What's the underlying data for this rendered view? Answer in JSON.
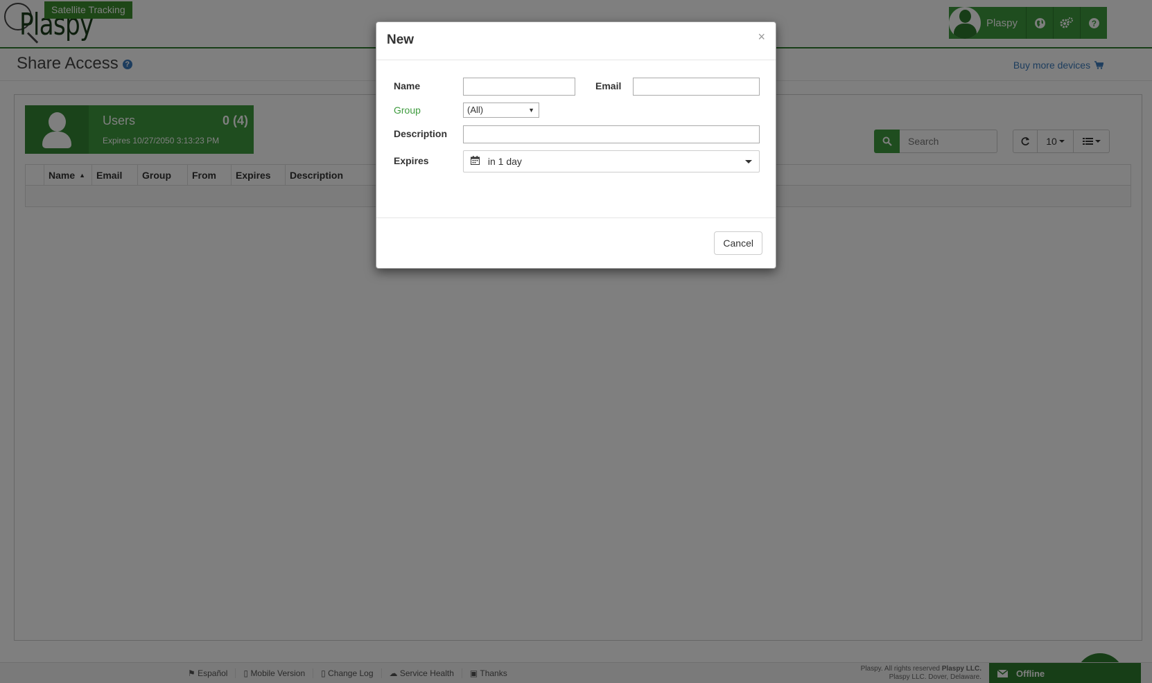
{
  "app": {
    "logo_text": "Plaspy",
    "badge": "Satellite Tracking",
    "user_name": "Plaspy"
  },
  "header_icons": [
    "globe-icon",
    "gears-icon",
    "question-icon"
  ],
  "page": {
    "title": "Share Access",
    "buy_link": "Buy more devices"
  },
  "users_card": {
    "label": "Users",
    "count": "0 (4)",
    "expires": "Expires 10/27/2050 3:13:23 PM"
  },
  "search": {
    "placeholder": "Search"
  },
  "toolbar": {
    "page_size": "10"
  },
  "table": {
    "columns": [
      "Name",
      "Email",
      "Group",
      "From",
      "Expires",
      "Description"
    ]
  },
  "footer": {
    "links": [
      "Español",
      "Mobile Version",
      "Change Log",
      "Service Health",
      "Thanks"
    ],
    "copyright_prefix": "Plaspy. All rights reserved",
    "copyright_company": "Plaspy LLC.",
    "address": "Plaspy LLC. Dover, Delaware.",
    "offline": "Offline"
  },
  "modal": {
    "title": "New",
    "close": "×",
    "name_label": "Name",
    "name_value": "",
    "email_label": "Email",
    "email_value": "",
    "group_label": "Group",
    "group_selected": "(All)",
    "description_label": "Description",
    "description_value": "",
    "expires_label": "Expires",
    "expires_value": "in 1 day",
    "cancel": "Cancel"
  },
  "colors": {
    "brand_green": "#3e9b3e",
    "dark_green": "#2e7d2e",
    "link_blue": "#3a7bbd"
  }
}
